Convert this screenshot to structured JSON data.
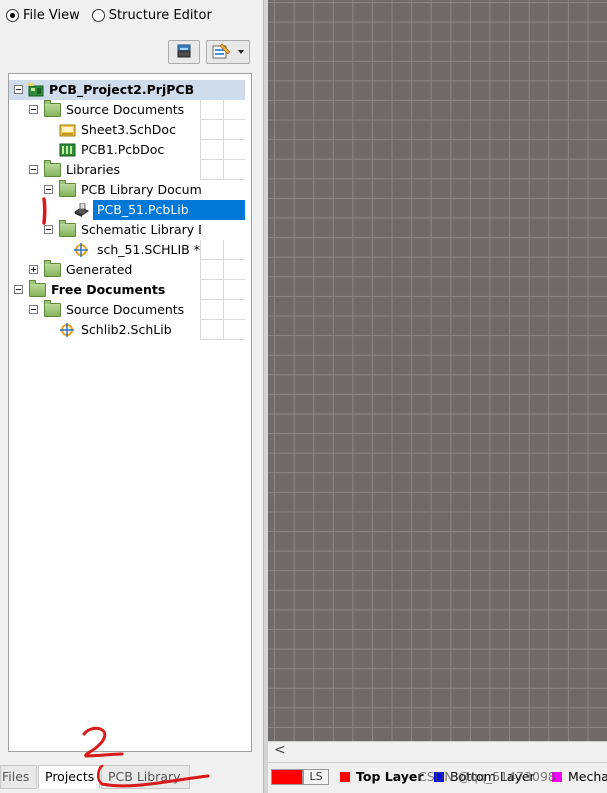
{
  "view_toggle": {
    "file_view": "File View",
    "structure_editor": "Structure Editor",
    "selected": "file_view"
  },
  "toolbar": {
    "button1_icon": "stack-icon",
    "button2_icon": "edit-dropdown-icon"
  },
  "tree": {
    "project": "PCB_Project2.PrjPCB",
    "source_documents": "Source Documents",
    "sheet3": "Sheet3.SchDoc",
    "pcb1": "PCB1.PcbDoc",
    "libraries": "Libraries",
    "pcb_library_documents": "PCB Library Docum",
    "pcb51": "PCB_51.PcbLib",
    "schematic_library_documents": "Schematic Library D",
    "sch51": "sch_51.SCHLIB *",
    "generated": "Generated",
    "free_documents": "Free Documents",
    "free_source_documents": "Source Documents",
    "schlib2": "Schlib2.SchLib"
  },
  "bottom_tabs": {
    "files": "Files",
    "projects": "Projects",
    "pcb_library": "PCB Library"
  },
  "annotations": {
    "mark_1": "1",
    "mark_2": "2"
  },
  "scrollbar": {
    "left_arrow": "<"
  },
  "layer_bar": {
    "ls_label": "LS",
    "top_layer": "Top Layer",
    "bottom_layer": "Bottom Layer",
    "mech": "Mecha",
    "watermark": "CSDN @qq_51473098",
    "colors": {
      "ls": "#ff0000",
      "top": "#ff0000",
      "bottom": "#0000ff",
      "mech": "#ff00ff"
    }
  },
  "colors": {
    "canvas_bg": "#6e6a6a",
    "grid_line": "#8a8787",
    "selection": "#0078d7",
    "project_row": "#cfdceb",
    "annotation": "#d91a1a"
  }
}
